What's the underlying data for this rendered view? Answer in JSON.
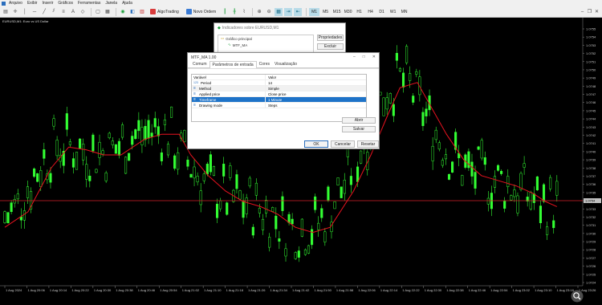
{
  "menu": {
    "items": [
      "Arquivo",
      "Exibir",
      "Inserir",
      "Gráficos",
      "Ferramentas",
      "Janela",
      "Ajuda"
    ]
  },
  "toolbar": {
    "algotrading_label": "AlgoTrading",
    "new_order_label": "Novo Ordem",
    "timeframes": [
      "M1",
      "M5",
      "M15",
      "M30",
      "H1",
      "H4",
      "D1",
      "W1",
      "MN"
    ],
    "active_timeframe": "M1"
  },
  "chart": {
    "title": "EURUSD,M1: Euro vs US Dollar",
    "colors": {
      "background": "#000000",
      "candle": "#33ff33",
      "ma": "#e8121f",
      "price_line": "#d4202a"
    },
    "current_price_label": "1.0754",
    "price_labels": [
      "1.0755",
      "1.0754",
      "1.0753",
      "1.0752",
      "1.0751",
      "1.0750",
      "1.0749",
      "1.0748",
      "1.0747",
      "1.0746",
      "1.0745",
      "1.0744",
      "1.0743",
      "1.0742",
      "1.0741",
      "1.0740",
      "1.0739",
      "1.0738",
      "1.0737",
      "1.0736",
      "1.0735",
      "1.0734",
      "1.0733",
      "1.0732",
      "1.0731",
      "1.0730",
      "1.0729",
      "1.0728",
      "1.0727",
      "1.0726",
      "1.0725",
      "1.0724"
    ],
    "time_labels": [
      "1 Aug 2024",
      "1 Aug 20:06",
      "1 Aug 20:14",
      "1 Aug 20:22",
      "1 Aug 20:30",
      "1 Aug 20:38",
      "1 Aug 20:46",
      "1 Aug 20:54",
      "1 Aug 21:02",
      "1 Aug 21:10",
      "1 Aug 21:18",
      "1 Aug 21:26",
      "1 Aug 21:34",
      "1 Aug 21:42",
      "1 Aug 21:50",
      "1 Aug 21:58",
      "1 Aug 22:06",
      "1 Aug 22:14",
      "1 Aug 22:22",
      "1 Aug 22:30",
      "1 Aug 22:38",
      "1 Aug 22:46",
      "1 Aug 22:54",
      "1 Aug 23:02",
      "1 Aug 23:10",
      "1 Aug 23:18",
      "1 Aug 23:26"
    ]
  },
  "chart_data": {
    "type": "candlestick",
    "title": "EURUSD,M1: Euro vs US Dollar",
    "series": [
      {
        "name": "EURUSD M1"
      },
      {
        "name": "MTF_MA (14, Simple, Close price, 1 Minute)"
      }
    ],
    "ma_points": [
      [
        0,
        0.22
      ],
      [
        0.04,
        0.28
      ],
      [
        0.08,
        0.45
      ],
      [
        0.11,
        0.53
      ],
      [
        0.14,
        0.52
      ],
      [
        0.17,
        0.5
      ],
      [
        0.2,
        0.5
      ],
      [
        0.24,
        0.56
      ],
      [
        0.27,
        0.58
      ],
      [
        0.3,
        0.58
      ],
      [
        0.32,
        0.5
      ],
      [
        0.35,
        0.42
      ],
      [
        0.38,
        0.36
      ],
      [
        0.41,
        0.32
      ],
      [
        0.44,
        0.3
      ],
      [
        0.47,
        0.27
      ],
      [
        0.5,
        0.22
      ],
      [
        0.53,
        0.2
      ],
      [
        0.56,
        0.22
      ],
      [
        0.6,
        0.36
      ],
      [
        0.63,
        0.5
      ],
      [
        0.66,
        0.66
      ],
      [
        0.68,
        0.76
      ],
      [
        0.71,
        0.78
      ],
      [
        0.73,
        0.7
      ],
      [
        0.76,
        0.58
      ],
      [
        0.79,
        0.48
      ],
      [
        0.82,
        0.42
      ],
      [
        0.85,
        0.4
      ],
      [
        0.88,
        0.38
      ],
      [
        0.91,
        0.35
      ],
      [
        0.93,
        0.32
      ],
      [
        0.95,
        0.3
      ]
    ]
  },
  "indicators_dialog": {
    "title": "Indicadores sobre EURUSD,M1",
    "tree_root": "Gráfico principal",
    "tree_child": "MTF_MA",
    "properties_button": "Propriedades",
    "delete_button": "Excluir"
  },
  "mtf_dialog": {
    "title": "MTF_MA 1.00",
    "tabs": [
      "Comum",
      "Parâmetros de entrada",
      "Cores",
      "Visualização"
    ],
    "active_tab": "Parâmetros de entrada",
    "header": {
      "variable": "Variável",
      "value": "Valor"
    },
    "params": [
      {
        "icon": "123",
        "name": "Period",
        "value": "14"
      },
      {
        "icon": "≡",
        "name": "Method",
        "value": "Simple"
      },
      {
        "icon": "≡",
        "name": "Applied price",
        "value": "Close price"
      },
      {
        "icon": "≡",
        "name": "Timeframe",
        "value": "1 Minute"
      },
      {
        "icon": "≡",
        "name": "Drawing mode",
        "value": "Steps"
      }
    ],
    "selected_row": 3,
    "load_button": "Abrir",
    "save_button": "Salvar",
    "ok_button": "OK",
    "cancel_button": "Cancelar",
    "reset_button": "Resetar"
  }
}
